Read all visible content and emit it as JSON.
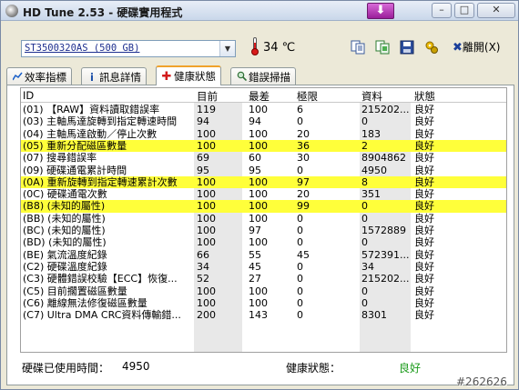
{
  "window": {
    "title": "HD Tune 2.53 - 硬碟實用程式"
  },
  "titlebar_controls": {
    "minimize": "–",
    "maximize": "□",
    "close": "✕"
  },
  "toolbar": {
    "drive": "ST3500320AS (500 GB)",
    "temperature": "34 ℃",
    "exit_label": "離開(X)",
    "exit_icon_glyph": "✖"
  },
  "tabs": [
    {
      "label": "效率指標",
      "icon": "chart-icon"
    },
    {
      "label": "訊息詳情",
      "icon": "info-icon"
    },
    {
      "label": "健康狀態",
      "icon": "health-cross-icon"
    },
    {
      "label": "錯誤掃描",
      "icon": "magnifier-icon"
    }
  ],
  "table": {
    "headers": [
      "ID",
      "目前",
      "最差",
      "極限",
      "資料",
      "狀態"
    ],
    "rows": [
      {
        "id": "(01) 【RAW】資料讀取錯誤率",
        "cur": "119",
        "worst": "100",
        "thr": "6",
        "data": "215202...",
        "status": "良好",
        "hl": false
      },
      {
        "id": "(03) 主軸馬達旋轉到指定轉速時間",
        "cur": "94",
        "worst": "94",
        "thr": "0",
        "data": "0",
        "status": "良好",
        "hl": false
      },
      {
        "id": "(04) 主軸馬達啟動／停止次數",
        "cur": "100",
        "worst": "100",
        "thr": "20",
        "data": "183",
        "status": "良好",
        "hl": false
      },
      {
        "id": "(05) 重新分配磁區數量",
        "cur": "100",
        "worst": "100",
        "thr": "36",
        "data": "2",
        "status": "良好",
        "hl": true
      },
      {
        "id": "(07) 搜尋錯誤率",
        "cur": "69",
        "worst": "60",
        "thr": "30",
        "data": "8904862",
        "status": "良好",
        "hl": false
      },
      {
        "id": "(09) 硬碟通電累計時間",
        "cur": "95",
        "worst": "95",
        "thr": "0",
        "data": "4950",
        "status": "良好",
        "hl": false
      },
      {
        "id": "(0A) 重新旋轉到指定轉速累計次數",
        "cur": "100",
        "worst": "100",
        "thr": "97",
        "data": "8",
        "status": "良好",
        "hl": true
      },
      {
        "id": "(0C) 硬碟通電次數",
        "cur": "100",
        "worst": "100",
        "thr": "20",
        "data": "351",
        "status": "良好",
        "hl": false
      },
      {
        "id": "(B8) (未知的屬性)",
        "cur": "100",
        "worst": "100",
        "thr": "99",
        "data": "0",
        "status": "良好",
        "hl": true
      },
      {
        "id": "(BB) (未知的屬性)",
        "cur": "100",
        "worst": "100",
        "thr": "0",
        "data": "0",
        "status": "良好",
        "hl": false
      },
      {
        "id": "(BC) (未知的屬性)",
        "cur": "100",
        "worst": "97",
        "thr": "0",
        "data": "1572889",
        "status": "良好",
        "hl": false
      },
      {
        "id": "(BD) (未知的屬性)",
        "cur": "100",
        "worst": "100",
        "thr": "0",
        "data": "0",
        "status": "良好",
        "hl": false
      },
      {
        "id": "(BE) 氣流溫度紀錄",
        "cur": "66",
        "worst": "55",
        "thr": "45",
        "data": "572391...",
        "status": "良好",
        "hl": false
      },
      {
        "id": "(C2) 硬碟溫度紀錄",
        "cur": "34",
        "worst": "45",
        "thr": "0",
        "data": "34",
        "status": "良好",
        "hl": false
      },
      {
        "id": "(C3) 硬體錯誤校驗【ECC】恢復...",
        "cur": "52",
        "worst": "27",
        "thr": "0",
        "data": "215202...",
        "status": "良好",
        "hl": false
      },
      {
        "id": "(C5) 目前擱置磁區數量",
        "cur": "100",
        "worst": "100",
        "thr": "0",
        "data": "0",
        "status": "良好",
        "hl": false
      },
      {
        "id": "(C6) 離線無法修復磁區數量",
        "cur": "100",
        "worst": "100",
        "thr": "0",
        "data": "0",
        "status": "良好",
        "hl": false
      },
      {
        "id": "(C7) Ultra DMA CRC資料傳輸錯...",
        "cur": "200",
        "worst": "143",
        "thr": "0",
        "data": "8301",
        "status": "良好",
        "hl": false
      }
    ]
  },
  "summary": {
    "hours_label": "硬碟已使用時間：",
    "hours_value": "4950",
    "health_label": "健康狀態：",
    "health_value": "良好"
  },
  "watermark": "#262626",
  "colors": {
    "highlight": "#ffff3a",
    "healthy": "#1a9a1a",
    "drive_text": "#1e2f8f"
  }
}
